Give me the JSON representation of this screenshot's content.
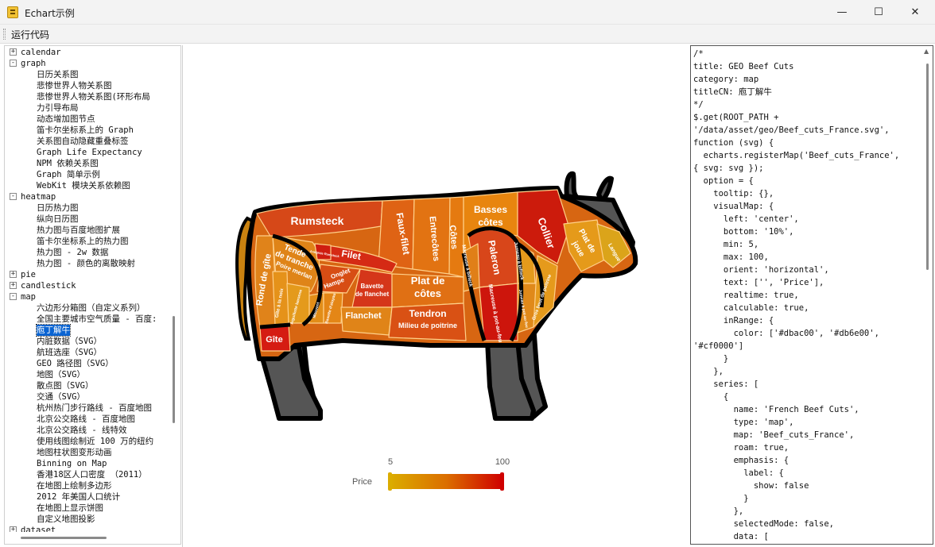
{
  "window": {
    "title": "Echart示例",
    "minimize": "—",
    "maximize": "☐",
    "close": "✕"
  },
  "toolbar": {
    "run_label": "运行代码"
  },
  "tree": {
    "nodes": [
      {
        "label": "calendar",
        "level": 0,
        "toggle": "+"
      },
      {
        "label": "graph",
        "level": 0,
        "toggle": "-"
      },
      {
        "label": "日历关系图",
        "level": 1
      },
      {
        "label": "悲惨世界人物关系图",
        "level": 1
      },
      {
        "label": "悲惨世界人物关系图(环形布局",
        "level": 1
      },
      {
        "label": "力引导布局",
        "level": 1
      },
      {
        "label": "动态增加图节点",
        "level": 1
      },
      {
        "label": "笛卡尔坐标系上的 Graph",
        "level": 1
      },
      {
        "label": "关系图自动隐藏重叠标签",
        "level": 1
      },
      {
        "label": "Graph Life Expectancy",
        "level": 1
      },
      {
        "label": "NPM 依赖关系图",
        "level": 1
      },
      {
        "label": "Graph 简单示例",
        "level": 1
      },
      {
        "label": "WebKit 模块关系依赖图",
        "level": 1
      },
      {
        "label": "heatmap",
        "level": 0,
        "toggle": "-"
      },
      {
        "label": "日历热力图",
        "level": 1
      },
      {
        "label": "纵向日历图",
        "level": 1
      },
      {
        "label": "热力图与百度地图扩展",
        "level": 1
      },
      {
        "label": "笛卡尔坐标系上的热力图",
        "level": 1
      },
      {
        "label": "热力图 - 2w 数据",
        "level": 1
      },
      {
        "label": "热力图 - 颜色的离散映射",
        "level": 1
      },
      {
        "label": "pie",
        "level": 0,
        "toggle": "+"
      },
      {
        "label": "candlestick",
        "level": 0,
        "toggle": "+"
      },
      {
        "label": "map",
        "level": 0,
        "toggle": "-"
      },
      {
        "label": "六边形分箱图（自定义系列）",
        "level": 1
      },
      {
        "label": "全国主要城市空气质量 - 百度:",
        "level": 1
      },
      {
        "label": "庖丁解牛",
        "level": 1,
        "selected": true
      },
      {
        "label": "内脏数据（SVG）",
        "level": 1
      },
      {
        "label": "航班选座（SVG）",
        "level": 1
      },
      {
        "label": "GEO 路径图（SVG）",
        "level": 1
      },
      {
        "label": "地图（SVG）",
        "level": 1
      },
      {
        "label": "散点图（SVG）",
        "level": 1
      },
      {
        "label": "交通（SVG）",
        "level": 1
      },
      {
        "label": "杭州热门步行路线 - 百度地图",
        "level": 1
      },
      {
        "label": "北京公交路线 - 百度地图",
        "level": 1
      },
      {
        "label": "北京公交路线 - 线特效",
        "level": 1
      },
      {
        "label": "使用线图绘制近 100 万的纽约",
        "level": 1
      },
      {
        "label": "地图柱状图变形动画",
        "level": 1
      },
      {
        "label": "Binning on Map",
        "level": 1
      },
      {
        "label": "香港18区人口密度 （2011）",
        "level": 1
      },
      {
        "label": "在地图上绘制多边形",
        "level": 1
      },
      {
        "label": "2012 年美国人口统计",
        "level": 1
      },
      {
        "label": "在地图上显示饼图",
        "level": 1
      },
      {
        "label": "自定义地图投影",
        "level": 1
      },
      {
        "label": "dataset",
        "level": 0,
        "toggle": "+"
      }
    ]
  },
  "chart": {
    "visual_map": {
      "min": 5,
      "max": 100,
      "text": "Price",
      "colors": [
        "#dbac00",
        "#db6e00",
        "#cf0000"
      ]
    },
    "cuts": {
      "rumsteck": "Rumsteck",
      "faux_filet": "Faux-filet",
      "entrecotes": "Entrecôtes",
      "cotes": "Côtes",
      "basses_cotes_1": "Basses",
      "basses_cotes_2": "côtes",
      "collier": "Collier",
      "plat_de_joue_1": "Plat de",
      "plat_de_joue_2": "joue",
      "langue": "Langue",
      "rond_de_gite": "Rond de gîte",
      "tende_1": "Tende",
      "tende_2": "de tranche",
      "poire_merlan": "Poire merlan",
      "filet": "Filet",
      "araignee": "Araignée Rumsteck",
      "onglet": "Onglet",
      "hampe": "Hampe",
      "bavette_flanchet_1": "Bavette",
      "bavette_flanchet_2": "de flanchet",
      "plat_cotes_1": "Plat de",
      "plat_cotes_2": "côtes",
      "paleron": "Paleron",
      "macreuse_bifteck": "Macreuse à bifteck",
      "jumeau_bifteck": "Jumeau à bifteck",
      "gite_noix": "Gîte à la noix",
      "aiguillette": "Aiguillette baronne",
      "mouvant": "Mouvant",
      "bavette_aloyau": "Bavette d'aloyau",
      "flanchet": "Flanchet",
      "tendron": "Tendron",
      "milieu_poitrine": "Milieu de poitrine",
      "macreuse_pot": "Macreuse à pot-au-feu",
      "jumeau_pot": "Jumeau à pot-au-feu",
      "gros_bout": "Gros bout de poitrine",
      "gite": "Gîte"
    }
  },
  "code": {
    "lines": [
      "/*",
      "title: GEO Beef Cuts",
      "category: map",
      "titleCN: 庖丁解牛",
      "*/",
      "$.get(ROOT_PATH +",
      "'/data/asset/geo/Beef_cuts_France.svg',",
      "function (svg) {",
      "  echarts.registerMap('Beef_cuts_France',",
      "{ svg: svg });",
      "  option = {",
      "    tooltip: {},",
      "    visualMap: {",
      "      left: 'center',",
      "      bottom: '10%',",
      "      min: 5,",
      "      max: 100,",
      "      orient: 'horizontal',",
      "      text: ['', 'Price'],",
      "      realtime: true,",
      "      calculable: true,",
      "      inRange: {",
      "        color: ['#dbac00', '#db6e00',",
      "'#cf0000']",
      "      }",
      "    },",
      "    series: [",
      "      {",
      "        name: 'French Beef Cuts',",
      "        type: 'map',",
      "        map: 'Beef_cuts_France',",
      "        roam: true,",
      "        emphasis: {",
      "          label: {",
      "            show: false",
      "          }",
      "        },",
      "        selectedMode: false,",
      "        data: ["
    ]
  }
}
